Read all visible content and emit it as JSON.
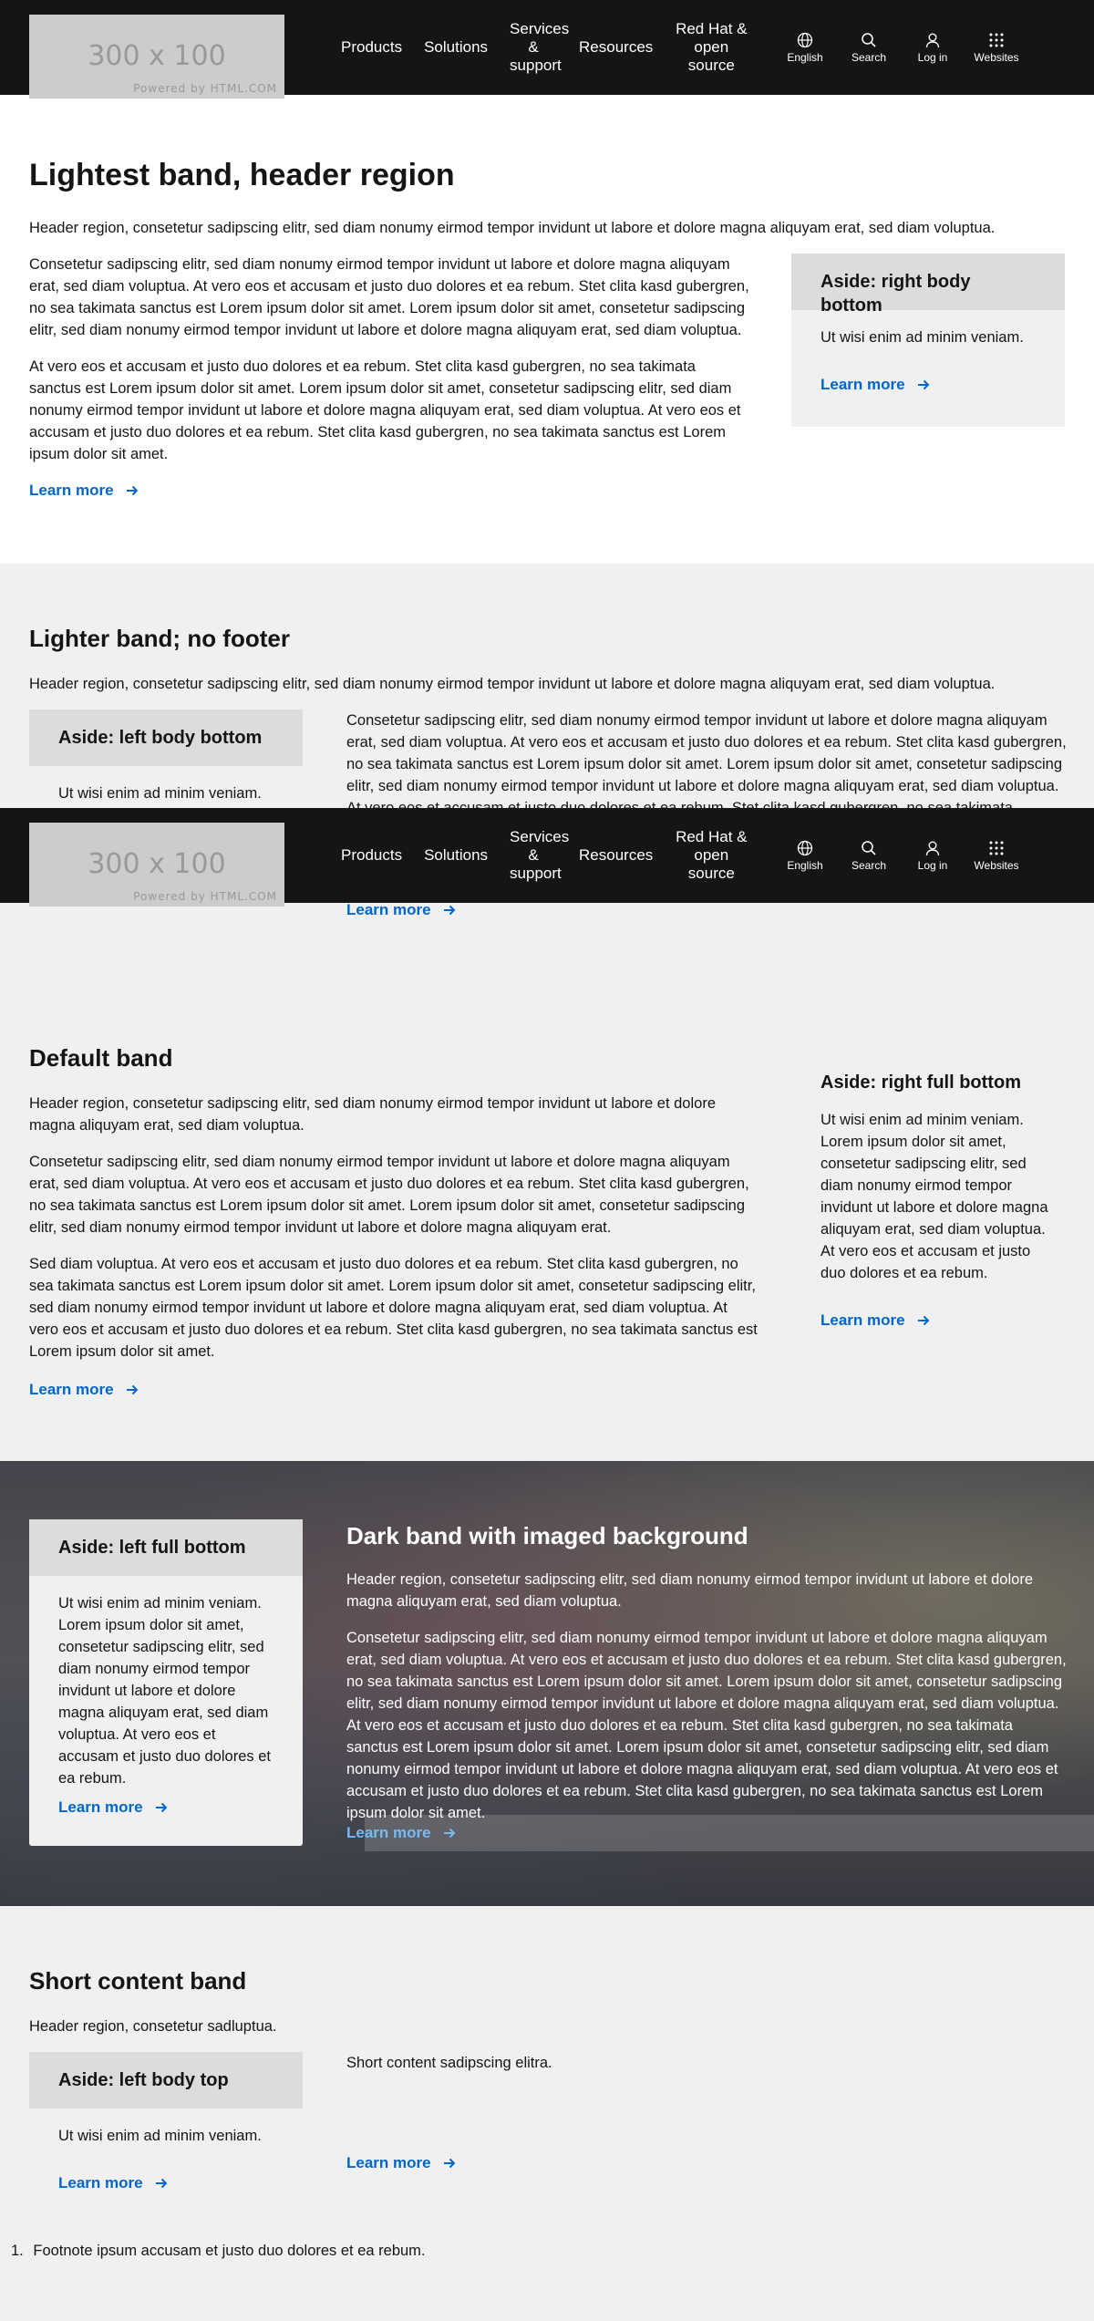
{
  "nav": {
    "logo_size": "300 x 100",
    "logo_powered": "Powered by HTML.COM",
    "links": [
      "Products",
      "Solutions",
      "Services & support",
      "Resources",
      "Red Hat & open source"
    ],
    "tools": [
      "English",
      "Search",
      "Log in",
      "Websites"
    ]
  },
  "lightest": {
    "title": "Lightest band, header region",
    "header_text": "Header region, consetetur sadipscing elitr, sed diam nonumy eirmod tempor invidunt ut labore et dolore magna aliquyam erat, sed diam voluptua.",
    "para1": "Consetetur sadipscing elitr, sed diam nonumy eirmod tempor invidunt ut labore et dolore magna aliquyam erat, sed diam voluptua. At vero eos et accusam et justo duo dolores et ea rebum. Stet clita kasd gubergren, no sea takimata sanctus est Lorem ipsum dolor sit amet. Lorem ipsum dolor sit amet, consetetur sadipscing elitr, sed diam nonumy eirmod tempor invidunt ut labore et dolore magna aliquyam erat, sed diam voluptua.",
    "para2": "At vero eos et accusam et justo duo dolores et ea rebum. Stet clita kasd gubergren, no sea takimata sanctus est Lorem ipsum dolor sit amet. Lorem ipsum dolor sit amet, consetetur sadipscing elitr, sed diam nonumy eirmod tempor invidunt ut labore et dolore magna aliquyam erat, sed diam voluptua. At vero eos et accusam et justo duo dolores et ea rebum. Stet clita kasd gubergren, no sea takimata sanctus est Lorem ipsum dolor sit amet.",
    "link": "Learn more",
    "aside": {
      "title": "Aside: right body bottom",
      "body": "Ut wisi enim ad minim veniam.",
      "link": "Learn more"
    }
  },
  "lighter": {
    "title": "Lighter band; no footer",
    "header_text": "Header region, consetetur sadipscing elitr, sed diam nonumy eirmod tempor invidunt ut labore et dolore magna aliquyam erat, sed diam voluptua.",
    "body": "Consetetur sadipscing elitr, sed diam nonumy eirmod tempor invidunt ut labore et dolore magna aliquyam erat, sed diam voluptua. At vero eos et accusam et justo duo dolores et ea rebum. Stet clita kasd gubergren, no sea takimata sanctus est Lorem ipsum dolor sit amet. Lorem ipsum dolor sit amet, consetetur sadipscing elitr, sed diam nonumy eirmod tempor invidunt ut labore et dolore magna aliquyam erat, sed diam voluptua. At vero eos et accusam et justo duo dolores et ea rebum. Stet clita kasd gubergren, no sea takimata sanctus est Lorem ipsum dolor sit amet.",
    "link": "Learn more",
    "aside": {
      "title": "Aside: left body bottom",
      "body": "Ut wisi enim ad minim veniam."
    }
  },
  "default": {
    "title": "Default band",
    "header_text": "Header region, consetetur sadipscing elitr, sed diam nonumy eirmod tempor invidunt ut labore et dolore magna aliquyam erat, sed diam voluptua.",
    "para1": "Consetetur sadipscing elitr, sed diam nonumy eirmod tempor invidunt ut labore et dolore magna aliquyam erat, sed diam voluptua. At vero eos et accusam et justo duo dolores et ea rebum. Stet clita kasd gubergren, no sea takimata sanctus est Lorem ipsum dolor sit amet. Lorem ipsum dolor sit amet, consetetur sadipscing elitr, sed diam nonumy eirmod tempor invidunt ut labore et dolore magna aliquyam erat.",
    "para2": "Sed diam voluptua. At vero eos et accusam et justo duo dolores et ea rebum. Stet clita kasd gubergren, no sea takimata sanctus est Lorem ipsum dolor sit amet. Lorem ipsum dolor sit amet, consetetur sadipscing elitr, sed diam nonumy eirmod tempor invidunt ut labore et dolore magna aliquyam erat, sed diam voluptua. At vero eos et accusam et justo duo dolores et ea rebum. Stet clita kasd gubergren, no sea takimata sanctus est Lorem ipsum dolor sit amet.",
    "link": "Learn more",
    "aside": {
      "title": "Aside: right full bottom",
      "body": "Ut wisi enim ad minim veniam. Lorem ipsum dolor sit amet, consetetur sadipscing elitr, sed diam nonumy eirmod tempor invidunt ut labore et dolore magna aliquyam erat, sed diam voluptua. At vero eos et accusam et justo duo dolores et ea rebum.",
      "link": "Learn more"
    }
  },
  "dark": {
    "title": "Dark band with imaged background",
    "header_text": "Header region, consetetur sadipscing elitr, sed diam nonumy eirmod tempor invidunt ut labore et dolore magna aliquyam erat, sed diam voluptua.",
    "body": "Consetetur sadipscing elitr, sed diam nonumy eirmod tempor invidunt ut labore et dolore magna aliquyam erat, sed diam voluptua. At vero eos et accusam et justo duo dolores et ea rebum. Stet clita kasd gubergren, no sea takimata sanctus est Lorem ipsum dolor sit amet. Lorem ipsum dolor sit amet, consetetur sadipscing elitr, sed diam nonumy eirmod tempor invidunt ut labore et dolore magna aliquyam erat, sed diam voluptua. At vero eos et accusam et justo duo dolores et ea rebum. Stet clita kasd gubergren, no sea takimata sanctus est Lorem ipsum dolor sit amet. Lorem ipsum dolor sit amet, consetetur sadipscing elitr, sed diam nonumy eirmod tempor invidunt ut labore et dolore magna aliquyam erat, sed diam voluptua. At vero eos et accusam et justo duo dolores et ea rebum. Stet clita kasd gubergren, no sea takimata sanctus est Lorem ipsum dolor sit amet.",
    "link": "Learn more",
    "aside": {
      "title": "Aside: left full bottom",
      "body": "Ut wisi enim ad minim veniam. Lorem ipsum dolor sit amet, consetetur sadipscing elitr, sed diam nonumy eirmod tempor invidunt ut labore et dolore magna aliquyam erat, sed diam voluptua. At vero eos et accusam et justo duo dolores et ea rebum.",
      "link": "Learn more"
    }
  },
  "short": {
    "title": "Short content band",
    "header_text": "Header region, consetetur sadluptua.",
    "body": "Short content sadipscing elitra.",
    "link": "Learn more",
    "aside": {
      "title": "Aside: left body top",
      "body": "Ut wisi enim ad minim veniam.",
      "link": "Learn more"
    },
    "footnote_number": "1.",
    "footnote": "Footnote ipsum accusam et justo duo dolores et ea rebum."
  },
  "colors": {
    "nav_bg": "#151515",
    "link": "#0066cc",
    "band_light": "#f0f0f0",
    "aside_head": "#dcdcdc"
  }
}
